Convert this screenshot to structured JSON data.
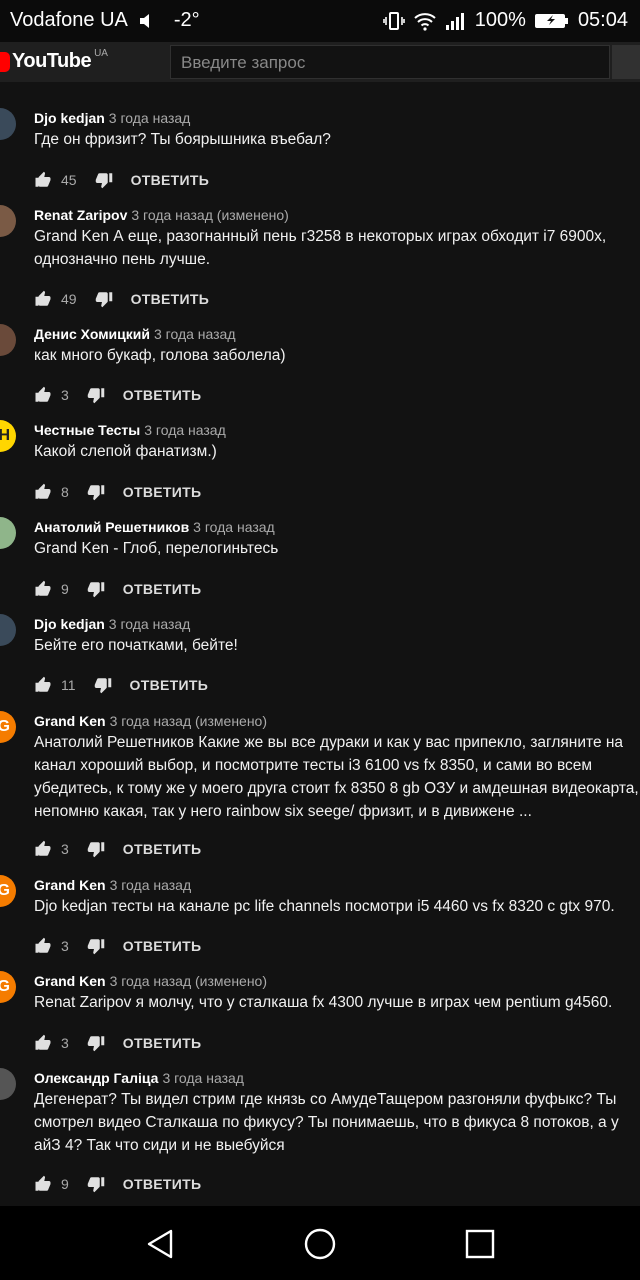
{
  "status_bar": {
    "carrier": "Vodafone UA",
    "temperature": "-2°",
    "battery": "100%",
    "time": "05:04"
  },
  "header": {
    "logo_text": "YouTube",
    "region": "UA",
    "search_placeholder": "Введите запрос"
  },
  "reply_label": "ОТВЕТИТЬ",
  "comments": [
    {
      "author": "Djo kedjan",
      "time": "3 года назад",
      "text": "Где он фризит? Ты боярышника въебал?",
      "likes": "45"
    },
    {
      "author": "Renat Zaripov",
      "time": "3 года назад (изменено)",
      "text": "Grand Ken А еще, разогнанный пень г3258 в некоторых играх обходит i7 6900х, однозначно пень лучше.",
      "likes": "49"
    },
    {
      "author": "Денис Хомицкий",
      "time": "3 года назад",
      "text": "как много букаф, голова заболела)",
      "likes": "3"
    },
    {
      "author": "Честные Тесты",
      "time": "3 года назад",
      "text": "Какой слепой фанатизм.)",
      "likes": "8"
    },
    {
      "author": "Анатолий Решетников",
      "time": "3 года назад",
      "text": "Grand Ken - Глоб, перелогиньтесь",
      "likes": "9"
    },
    {
      "author": "Djo kedjan",
      "time": "3 года назад",
      "text": "Бейте его початками, бейте!",
      "likes": "11"
    },
    {
      "author": "Grand Ken",
      "time": "3 года назад (изменено)",
      "text": "Анатолий Решетников Какие же вы все дураки и как у вас припекло, загляните на канал хороший выбор, и посмотрите тесты i3 6100 vs fx 8350, и сами во всем убедитесь, к тому же у моего друга стоит fx 8350 8 gb ОЗУ и амдешная видеокарта, непомню какая, так у него rainbow six seege/ фризит, и в дивижене ...",
      "likes": "3"
    },
    {
      "author": "Grand Ken",
      "time": "3 года назад",
      "text": "Djo kedjan тесты на канале pc life channels посмотри i5 4460 vs fx 8320 c gtx 970.",
      "likes": "3"
    },
    {
      "author": "Grand Ken",
      "time": "3 года назад (изменено)",
      "text": "Renat Zaripov я молчу, что у сталкаша fx 4300 лучше в играх чем pentium g4560.",
      "likes": "3"
    },
    {
      "author": "Олександр Галіца",
      "time": "3 года назад",
      "text": "Дегенерат? Ты видел стрим где князь со АмудеТащером разгоняли фуфыкс? Ты смотрел видео Сталкаша по фикусу? Ты понимаешь, что в фикуса 8 потоков, а у айЗ 4? Так что сиди и не выебуйся",
      "likes": "9"
    }
  ],
  "colors": {
    "background": "#121212",
    "header": "#1f1f1f",
    "accent": "#ff0000",
    "avatar_grand_ken": "#f57c00",
    "avatar_chestnye": "#ffd600"
  },
  "icons": [
    "mute-icon",
    "vibrate-icon",
    "wifi-icon",
    "signal-icon",
    "battery-icon",
    "like-icon",
    "dislike-icon",
    "back-icon",
    "home-icon",
    "recents-icon"
  ]
}
